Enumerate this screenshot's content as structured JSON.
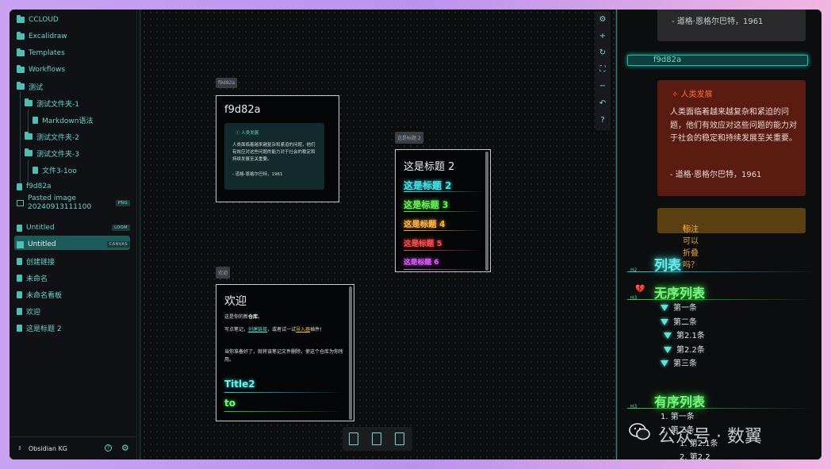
{
  "sidebar": {
    "items": [
      {
        "label": "CCLOUD",
        "type": "folder"
      },
      {
        "label": "Excalidraw",
        "type": "folder"
      },
      {
        "label": "Templates",
        "type": "folder"
      },
      {
        "label": "Workflows",
        "type": "folder"
      },
      {
        "label": "测试",
        "type": "folder-open"
      },
      {
        "label": "测试文件夹-1",
        "type": "folder-open"
      },
      {
        "label": "Markdown语法",
        "type": "file"
      },
      {
        "label": "测试文件夹-2",
        "type": "folder"
      },
      {
        "label": "测试文件夹-3",
        "type": "folder-open"
      },
      {
        "label": "文件3-1oo",
        "type": "file"
      },
      {
        "label": "f9d82a",
        "type": "file"
      },
      {
        "label": "Pasted image 20240913111100",
        "type": "image",
        "tag": "PNG"
      },
      {
        "label": "Untitled",
        "type": "file",
        "tag": "LOOM"
      },
      {
        "label": "Untitled",
        "type": "canvas",
        "tag": "CANVAS"
      },
      {
        "label": "创建链接",
        "type": "file"
      },
      {
        "label": "未命名",
        "type": "file"
      },
      {
        "label": "未命名看板",
        "type": "file"
      },
      {
        "label": "欢迎",
        "type": "file"
      },
      {
        "label": "这是标题 2",
        "type": "file"
      }
    ],
    "vault_name": "Obsidian KG"
  },
  "canvas": {
    "card1": {
      "label": "f9d82a",
      "title": "f9d82a",
      "callout_title": "ⓘ 人类发展",
      "callout_body": "人类面临着越来越复杂和紧迫的问题，他们有效应对这些问题的能力对于社会的稳定和持续发展至关重要。",
      "callout_quote": "- 道格·恩格尔巴特，1961"
    },
    "card2": {
      "label": "这是标题 2",
      "title": "这是标题 2",
      "rows": [
        {
          "text": "这是标题 2",
          "color": "#48e0e8"
        },
        {
          "text": "这是标题 3",
          "color": "#66ee55"
        },
        {
          "text": "这是标题 4",
          "color": "#ffb347"
        },
        {
          "text": "这是标题 5",
          "color": "#ff4a4a"
        },
        {
          "text": "这是标题 6",
          "color": "#e05cff"
        }
      ]
    },
    "card3": {
      "label": "欢迎",
      "title": "欢迎",
      "p1_prefix": "这是你的新",
      "p1_em": "仓库",
      "p1_suffix": "。",
      "p2_prefix": "写点笔记，",
      "p2_link": "创建链接",
      "p2_mid": "，或者试一试",
      "p2_plugin": "导入器",
      "p2_suffix": "插件!",
      "p3": "当你准备好了，就将该笔记文件删除，使这个仓库为你所用。",
      "neon1": "Title2",
      "neon2": "to"
    }
  },
  "right_pane": {
    "top_quote": "- 道格·恩格尔巴特，1961",
    "heading_bar": "f9d82a",
    "red_callout_title": "人类发展",
    "red_callout_body": "人类面临着越来越复杂和紧迫的问题，他们有效应对这些问题的能力对于社会的稳定和持续发展至关重要。",
    "red_callout_quote": "- 道格·恩格尔巴特，1961",
    "fold_note": "标注可以折叠吗？",
    "h2": "列表",
    "h3_unordered": "无序列表",
    "unordered": [
      "第一条",
      "第二条",
      "第2.1条",
      "第2.2条",
      "第三条"
    ],
    "h3_ordered": "有序列表",
    "ordered": [
      "1. 第一条",
      "2. 第二条",
      "1. 第2.1条",
      "2. 第2.2"
    ]
  },
  "watermark": "公众号 · 数翼",
  "colors": {
    "accent": "#4fd8c8",
    "neon_cyan": "#48e0e8",
    "neon_green": "#7ef582",
    "callout_red": "#5a1c11",
    "callout_orange": "#5a3f10"
  }
}
